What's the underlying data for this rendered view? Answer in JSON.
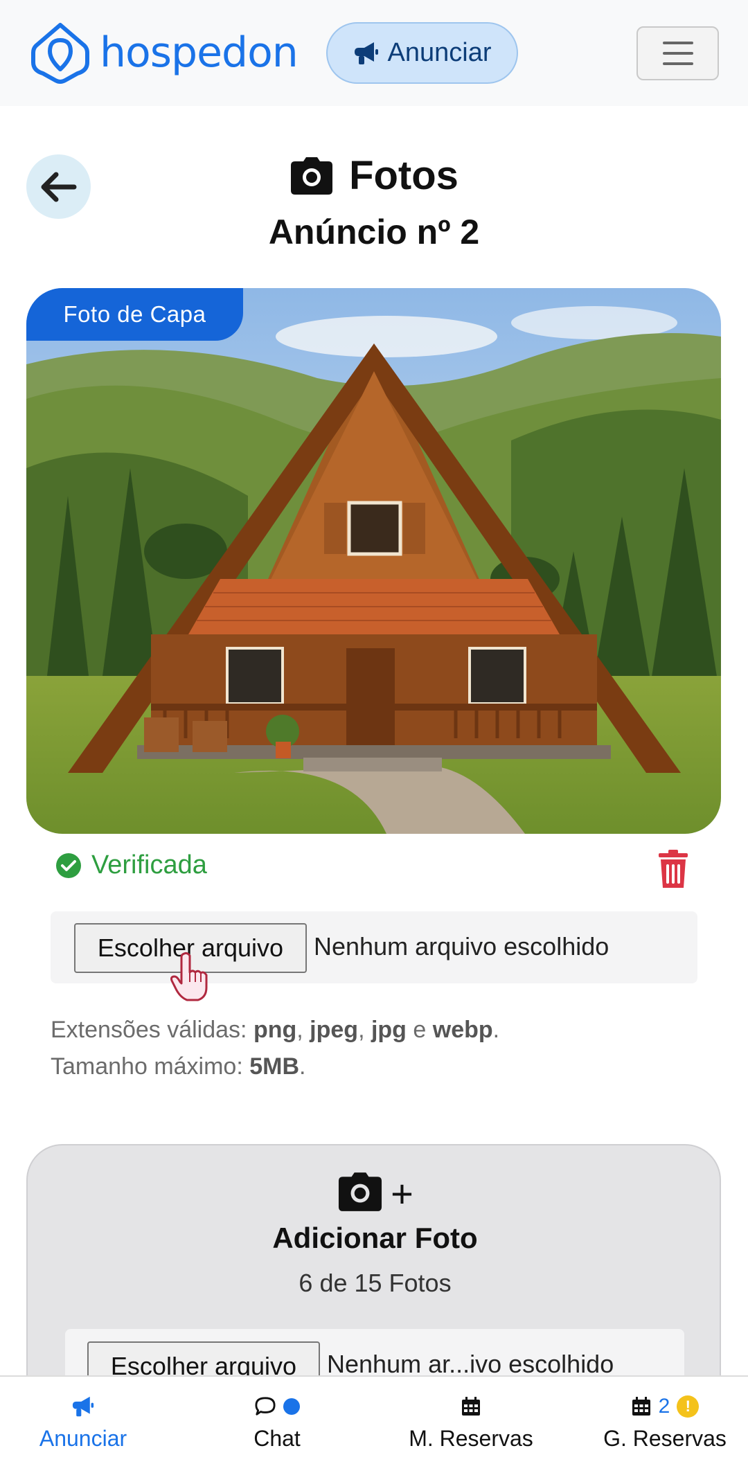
{
  "header": {
    "brand": "hospedon",
    "announce_button": "Anunciar",
    "menu_icon": "hamburger-icon",
    "colors": {
      "brand": "#1a73e8",
      "announce_bg": "#cfe4fa"
    }
  },
  "page": {
    "back_icon": "arrow-left-icon",
    "title_icon": "camera-icon",
    "title": "Fotos",
    "subtitle": "Anúncio nº 2"
  },
  "cover_photo": {
    "badge": "Foto de Capa",
    "status": "Verificada",
    "status_icon": "check-circle-icon",
    "delete_icon": "trash-icon",
    "status_color": "#2e9e40",
    "delete_color": "#dc3545"
  },
  "upload": {
    "button_label": "Escolher arquivo",
    "file_status": "Nenhum arquivo escolhido",
    "hint_line1": {
      "prefix": "Extensões válidas: ",
      "ext1": "png",
      "sep1": ", ",
      "ext2": "jpeg",
      "sep2": ", ",
      "ext3": "jpg",
      "sep3": " e ",
      "ext4": "webp",
      "suffix": "."
    },
    "hint_line2": {
      "prefix": "Tamanho máximo: ",
      "size": "5MB",
      "suffix": "."
    }
  },
  "add_photo": {
    "title": "Adicionar Foto",
    "plus": "+",
    "count": "6 de 15 Fotos",
    "button_label": "Escolher arquivo",
    "file_status": "Nenhum ar...ivo escolhido"
  },
  "bottom_nav": {
    "items": [
      {
        "label": "Anunciar",
        "icon": "megaphone-icon",
        "active": true
      },
      {
        "label": "Chat",
        "icon": "chat-bubble-icon",
        "indicator": "blue-dot"
      },
      {
        "label": "M. Reservas",
        "icon": "calendar-icon"
      },
      {
        "label": "G. Reservas",
        "icon": "calendar-icon",
        "count": "2",
        "alert": "!"
      }
    ]
  }
}
